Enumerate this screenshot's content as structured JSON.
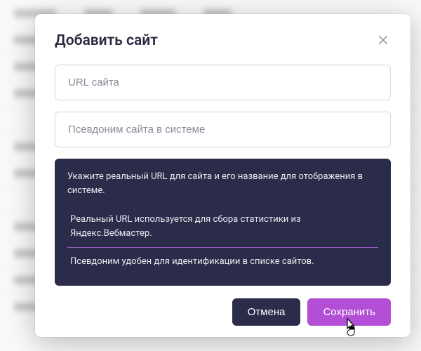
{
  "modal": {
    "title": "Добавить сайт",
    "url_placeholder": "URL сайта",
    "alias_placeholder": "Псевдоним сайта в системе",
    "info_main": "Укажите реальный URL для сайта и его название для отображения в системе.",
    "info_sub1": "Реальный URL используется для сбора статистики из Яндекс.Вебмастер.",
    "info_sub2": "Псевдоним удобен для идентификации в списке сайтов.",
    "cancel_label": "Отмена",
    "save_label": "Сохранить"
  }
}
